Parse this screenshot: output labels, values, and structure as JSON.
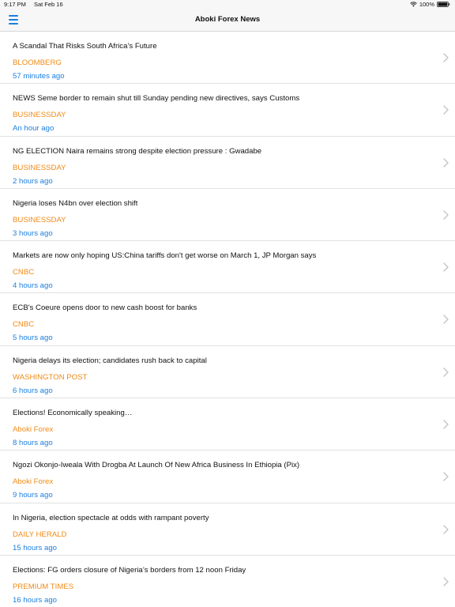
{
  "status": {
    "time": "9:17 PM",
    "date": "Sat Feb 16",
    "battery": "100%"
  },
  "nav": {
    "title": "Aboki Forex News",
    "menu_icon": "hamburger-menu-icon",
    "accent": "#1a7fe0"
  },
  "colors": {
    "source": "#f08b17",
    "time": "#1a7fe0"
  },
  "items": [
    {
      "headline": "A Scandal That Risks South Africa’s Future",
      "source": "BLOOMBERG",
      "time": "57 minutes ago"
    },
    {
      "headline": "NEWS Seme border to remain shut till Sunday pending new directives, says Customs",
      "source": "BUSINESSDAY",
      "time": "An hour ago"
    },
    {
      "headline": "NG ELECTION Naira remains strong despite election pressure : Gwadabe",
      "source": "BUSINESSDAY",
      "time": "2 hours ago"
    },
    {
      "headline": "Nigeria loses N4bn over election shift",
      "source": "BUSINESSDAY",
      "time": "3 hours ago"
    },
    {
      "headline": "Markets are now only hoping US:China tariffs don't get worse on March 1, JP Morgan says",
      "source": "CNBC",
      "time": "4 hours ago"
    },
    {
      "headline": "ECB's Coeure opens door to new cash boost for banks",
      "source": "CNBC",
      "time": "5 hours ago"
    },
    {
      "headline": "Nigeria delays its election; candidates rush back to capital",
      "source": "WASHINGTON POST",
      "time": "6 hours ago"
    },
    {
      "headline": "Elections! Economically speaking…",
      "source": "Aboki Forex",
      "time": "8 hours ago"
    },
    {
      "headline": "Ngozi Okonjo-Iweala With Drogba At Launch Of New Africa Business In Ethiopia (Pix)",
      "source": "Aboki Forex",
      "time": "9 hours ago"
    },
    {
      "headline": "In Nigeria, election spectacle at odds with rampant poverty",
      "source": "DAILY HERALD",
      "time": "15 hours ago"
    },
    {
      "headline": "Elections: FG orders closure of Nigeria’s borders from 12 noon Friday",
      "source": "PREMIUM TIMES",
      "time": "16 hours ago"
    }
  ]
}
